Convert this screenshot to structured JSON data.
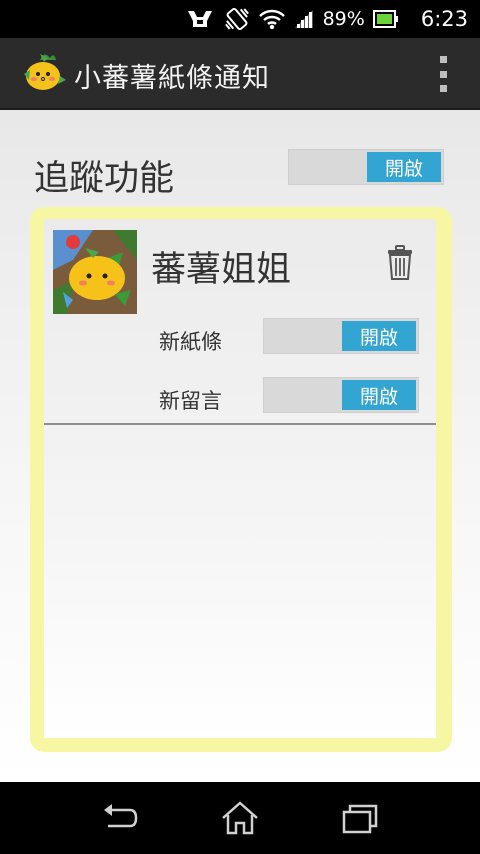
{
  "status_bar": {
    "battery": "89%",
    "time": "6:23",
    "icons": [
      "usb-debug-icon",
      "vibrate-icon",
      "wifi-icon",
      "signal-icon",
      "battery-icon"
    ]
  },
  "action_bar": {
    "title": "小蕃薯紙條通知",
    "logo": "sweet-potato-logo",
    "menu_icon": "overflow-menu-icon",
    "background": "#2b2b2b"
  },
  "tracking": {
    "label": "追蹤功能",
    "toggle_label": "開啟"
  },
  "contact": {
    "name": "蕃薯姐姐",
    "avatar": "sweet-potato-avatar",
    "delete_icon": "trash-icon",
    "settings": [
      {
        "label": "新紙條",
        "toggle_label": "開啟"
      },
      {
        "label": "新留言",
        "toggle_label": "開啟"
      }
    ]
  },
  "colors": {
    "accent": "#33a5d2",
    "card_border": "#f7f7a3",
    "toggle_track": "#d9d9d9"
  },
  "nav_bar": {
    "icons": [
      "back-icon",
      "home-icon",
      "recent-apps-icon"
    ]
  }
}
